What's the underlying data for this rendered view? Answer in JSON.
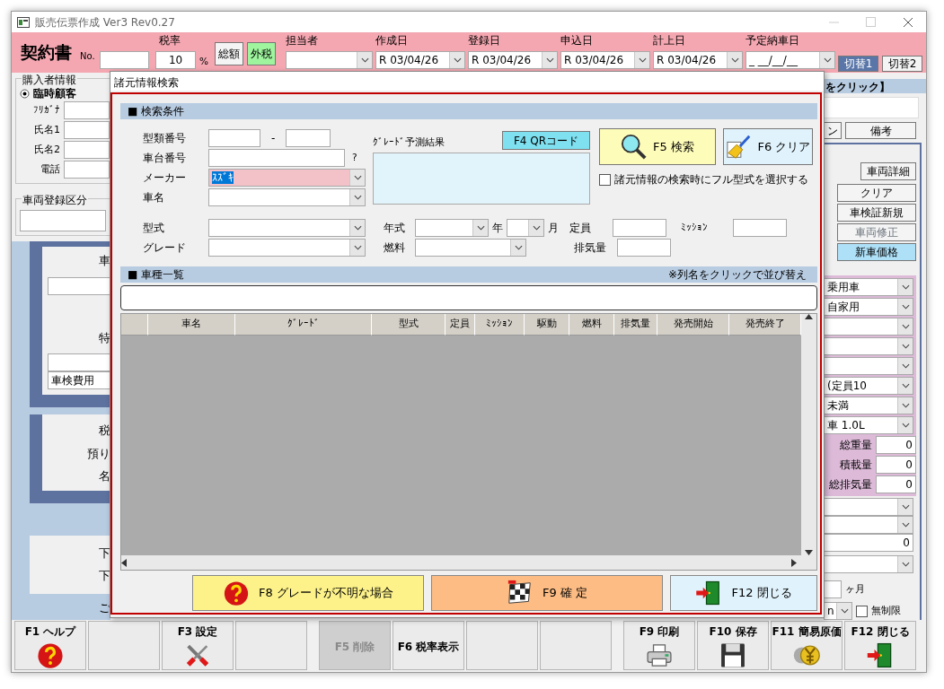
{
  "window": {
    "title": "販売伝票作成 Ver3 Rev0.27"
  },
  "header": {
    "title": "契約書",
    "number_label": "No.",
    "tax": {
      "label": "税率",
      "value": "10",
      "unit": "%"
    },
    "tax_modes": [
      {
        "label": "総額",
        "selected": false
      },
      {
        "label": "外税",
        "selected": true
      }
    ],
    "staff": {
      "label": "担当者"
    },
    "dates": [
      {
        "label": "作成日",
        "value": "R 03/04/26"
      },
      {
        "label": "登録日",
        "value": "R 03/04/26"
      },
      {
        "label": "申込日",
        "value": "R 03/04/26"
      },
      {
        "label": "計上日",
        "value": "R 03/04/26"
      },
      {
        "label": "予定納車日",
        "value": "_ __/__/__"
      }
    ],
    "switches": [
      {
        "label": "切替1",
        "selected": true
      },
      {
        "label": "切替2",
        "selected": false
      }
    ]
  },
  "left_panel": {
    "buyer": {
      "legend": "購入者情報",
      "customer_type": {
        "label": "臨時顧客",
        "selected": true
      },
      "fields": [
        {
          "label": "ﾌﾘｶﾞﾅ"
        },
        {
          "label": "氏名1"
        },
        {
          "label": "氏名2"
        },
        {
          "label": "電話"
        }
      ]
    },
    "registration": {
      "legend": "車両登録区分"
    },
    "vehicle_panel": {
      "labels": [
        "車",
        "特"
      ],
      "cost_field": "車検費用"
    },
    "tax_panel": {
      "labels": [
        "税",
        "預り",
        "名"
      ]
    },
    "lower_panel": {
      "labels": [
        "下",
        "下"
      ]
    },
    "footer": "ご"
  },
  "right_panel": {
    "banner": "をクリック】",
    "tabs": [
      {
        "label": "ン"
      },
      {
        "label": "備考"
      }
    ],
    "buttons": [
      {
        "label": "車両詳細",
        "kind": "normal"
      },
      {
        "label": "クリア",
        "kind": "normal"
      },
      {
        "label": "車検証新規",
        "kind": "normal"
      },
      {
        "label": "車両修正",
        "kind": "disabled"
      },
      {
        "label": "新車価格",
        "kind": "accent"
      }
    ],
    "upper_selects": [
      "乗用車",
      "自家用"
    ],
    "middle_selects": [
      "(定員10",
      "未満",
      "車 1.0L"
    ],
    "weights": [
      {
        "label": "総重量",
        "value": "0"
      },
      {
        "label": "積載量",
        "value": "0"
      },
      {
        "label": "総排気量",
        "value": "0"
      }
    ],
    "amount": "0",
    "period_unit": "ヶ月",
    "limit_select": "n",
    "unlimited": {
      "label": "無制限",
      "checked": false
    }
  },
  "dialog": {
    "title": "諸元情報検索",
    "search": {
      "heading": "■ 検索条件",
      "type_number": {
        "label": "型類番号",
        "separator": "-"
      },
      "chassis": {
        "label": "車台番号",
        "hint": "?"
      },
      "maker": {
        "label": "メーカー",
        "value": "ｽｽﾞｷ",
        "selected": true
      },
      "car_name": {
        "label": "車名"
      },
      "model": {
        "label": "型式"
      },
      "grade": {
        "label": "グレード"
      },
      "prediction": {
        "label": "ｸﾞﾚｰﾄﾞ予測結果"
      },
      "qr_button": "F4 QRコード",
      "search_button": "F5 検索",
      "clear_button": "F6 クリア",
      "full_model": {
        "label": "諸元情報の検索時にフル型式を選択する",
        "checked": false
      },
      "year": {
        "label": "年式",
        "unit": "年",
        "month_unit": "月"
      },
      "fuel": {
        "label": "燃料"
      },
      "capacity": {
        "label": "定員"
      },
      "transmission": {
        "label": "ﾐｯｼｮﾝ"
      },
      "displacement": {
        "label": "排気量"
      }
    },
    "list": {
      "heading": "■ 車種一覧",
      "sort_hint": "※列名をクリックで並び替え",
      "columns": [
        "車名",
        "ｸﾞﾚｰﾄﾞ",
        "型式",
        "定員",
        "ﾐｯｼｮﾝ",
        "駆動",
        "燃料",
        "排気量",
        "発売開始",
        "発売終了"
      ]
    },
    "actions": [
      {
        "label": "F8 グレードが不明な場合",
        "kind": "help"
      },
      {
        "label": "F9 確 定",
        "kind": "flag"
      },
      {
        "label": "F12 閉じる",
        "kind": "door"
      }
    ]
  },
  "function_keys": [
    {
      "label": "F1 ヘルプ",
      "kind": "help",
      "disabled": false
    },
    {
      "kind": "blank",
      "disabled": false
    },
    {
      "label": "F3 設定",
      "kind": "tools",
      "disabled": false
    },
    {
      "kind": "blank",
      "disabled": false
    },
    {
      "label": "F5 削除",
      "kind": "text",
      "disabled": true
    },
    {
      "label": "F6 税率表示",
      "kind": "text",
      "disabled": false
    },
    {
      "kind": "blank",
      "disabled": false
    },
    {
      "kind": "blank",
      "disabled": false
    },
    {
      "label": "F9 印刷",
      "kind": "printer",
      "disabled": false
    },
    {
      "label": "F10 保存",
      "kind": "floppy",
      "disabled": false
    },
    {
      "label": "F11 簡易原価",
      "kind": "coin",
      "disabled": false
    },
    {
      "label": "F12 閉じる",
      "kind": "door",
      "disabled": false
    }
  ]
}
